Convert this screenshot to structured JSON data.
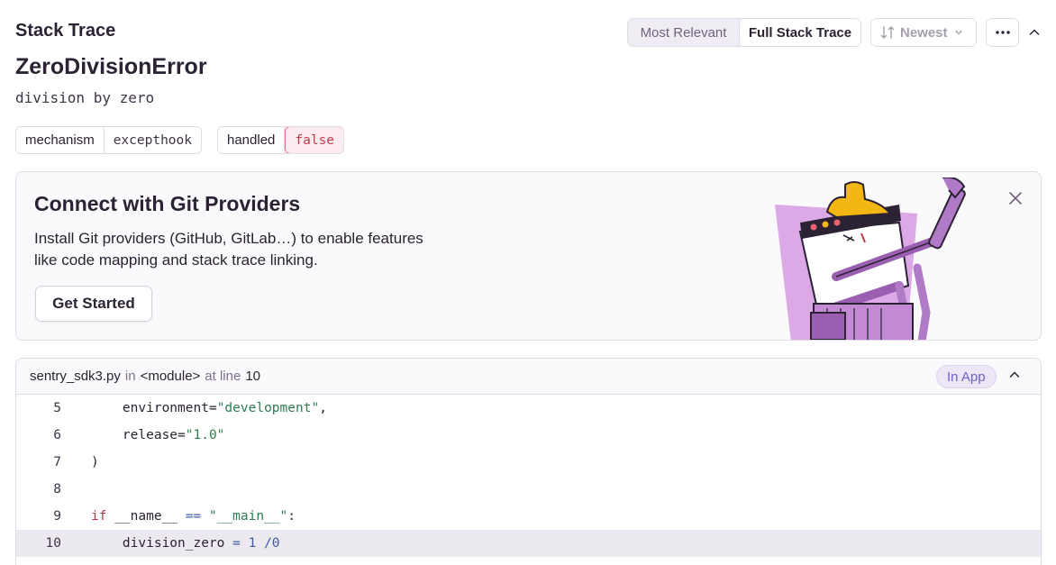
{
  "header": {
    "title": "Stack Trace"
  },
  "view_toggle": {
    "options": [
      "Most Relevant",
      "Full Stack Trace"
    ],
    "selected": "Full Stack Trace"
  },
  "sort": {
    "label": "Newest"
  },
  "error": {
    "type": "ZeroDivisionError",
    "value": "division by zero"
  },
  "tags": [
    {
      "key": "mechanism",
      "value": "excepthook"
    },
    {
      "key": "handled",
      "value": "false"
    }
  ],
  "git_banner": {
    "title": "Connect with Git Providers",
    "description": "Install Git providers (GitHub, GitLab…) to enable features like code mapping and stack trace linking.",
    "button": "Get Started"
  },
  "frame": {
    "file": "sentry_sdk3.py",
    "in_label": "in",
    "function": "<module>",
    "at_line_label": "at line",
    "line": "10",
    "badge": "In App",
    "code": [
      {
        "line": "5",
        "tokens": [
          {
            "t": "plain",
            "s": "    environment="
          },
          {
            "t": "str",
            "s": "\"development\""
          },
          {
            "t": "plain",
            "s": ","
          }
        ]
      },
      {
        "line": "6",
        "tokens": [
          {
            "t": "plain",
            "s": "    release="
          },
          {
            "t": "str",
            "s": "\"1.0\""
          }
        ]
      },
      {
        "line": "7",
        "tokens": [
          {
            "t": "plain",
            "s": ")"
          }
        ]
      },
      {
        "line": "8",
        "tokens": []
      },
      {
        "line": "9",
        "tokens": [
          {
            "t": "kw",
            "s": "if"
          },
          {
            "t": "plain",
            "s": " __name__ "
          },
          {
            "t": "op",
            "s": "=="
          },
          {
            "t": "plain",
            "s": " "
          },
          {
            "t": "str",
            "s": "\"__main__\""
          },
          {
            "t": "plain",
            "s": ":"
          }
        ]
      },
      {
        "line": "10",
        "active": true,
        "tokens": [
          {
            "t": "plain",
            "s": "    division_zero "
          },
          {
            "t": "op",
            "s": "="
          },
          {
            "t": "plain",
            "s": " "
          },
          {
            "t": "op",
            "s": "1"
          },
          {
            "t": "plain",
            "s": " "
          },
          {
            "t": "op",
            "s": "/0"
          }
        ]
      }
    ]
  },
  "colors": {
    "accent": "#6c5fc7",
    "error": "#c23a4b",
    "string": "#2f7d4f",
    "keyword": "#b4334a"
  }
}
